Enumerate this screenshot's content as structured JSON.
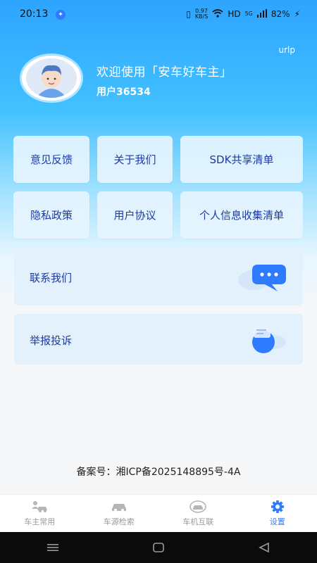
{
  "status_bar": {
    "time": "20:13",
    "net_speed_top": "0.97",
    "net_speed_bottom": "KB/S",
    "network": "HD",
    "signal": "5G",
    "battery": "82%"
  },
  "header": {
    "tag": "urlp",
    "welcome": "欢迎使用「安车好车主」",
    "user_id": "用户36534"
  },
  "grid": {
    "row1": [
      "意见反馈",
      "关于我们",
      "SDK共享清单"
    ],
    "row2": [
      "隐私政策",
      "用户协议",
      "个人信息收集清单"
    ]
  },
  "contact": {
    "label": "联系我们"
  },
  "report": {
    "label": "举报投诉"
  },
  "footer": {
    "record": "备案号：湘ICP备2025148895号-4A"
  },
  "bottom_nav": [
    {
      "label": "车主常用",
      "icon": "car-owner-icon"
    },
    {
      "label": "车源检索",
      "icon": "car-search-icon"
    },
    {
      "label": "车机互联",
      "icon": "car-connect-icon"
    },
    {
      "label": "设置",
      "icon": "gear-icon"
    }
  ],
  "colors": {
    "accent": "#2f7bff",
    "card_text": "#1c3aa3",
    "hero_top": "#2ea4ff"
  }
}
